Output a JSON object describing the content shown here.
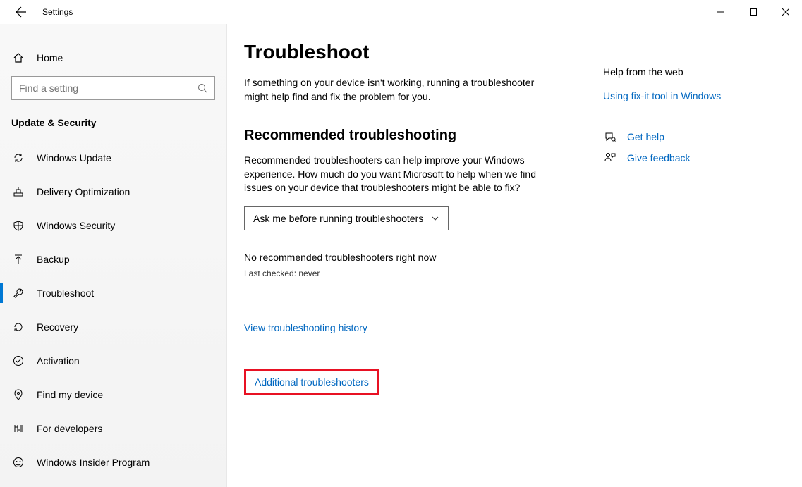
{
  "window": {
    "title": "Settings"
  },
  "sidebar": {
    "home": "Home",
    "search_placeholder": "Find a setting",
    "category": "Update & Security",
    "items": [
      {
        "label": "Windows Update"
      },
      {
        "label": "Delivery Optimization"
      },
      {
        "label": "Windows Security"
      },
      {
        "label": "Backup"
      },
      {
        "label": "Troubleshoot"
      },
      {
        "label": "Recovery"
      },
      {
        "label": "Activation"
      },
      {
        "label": "Find my device"
      },
      {
        "label": "For developers"
      },
      {
        "label": "Windows Insider Program"
      }
    ]
  },
  "content": {
    "title": "Troubleshoot",
    "intro": "If something on your device isn't working, running a troubleshooter might help find and fix the problem for you.",
    "section_title": "Recommended troubleshooting",
    "section_desc": "Recommended troubleshooters can help improve your Windows experience. How much do you want Microsoft to help when we find issues on your device that troubleshooters might be able to fix?",
    "dropdown_value": "Ask me before running troubleshooters",
    "status": "No recommended troubleshooters right now",
    "status_sub": "Last checked: never",
    "history_link": "View troubleshooting history",
    "additional_link": "Additional troubleshooters"
  },
  "aside": {
    "heading": "Help from the web",
    "weblink": "Using fix-it tool in Windows",
    "help": "Get help",
    "feedback": "Give feedback"
  }
}
